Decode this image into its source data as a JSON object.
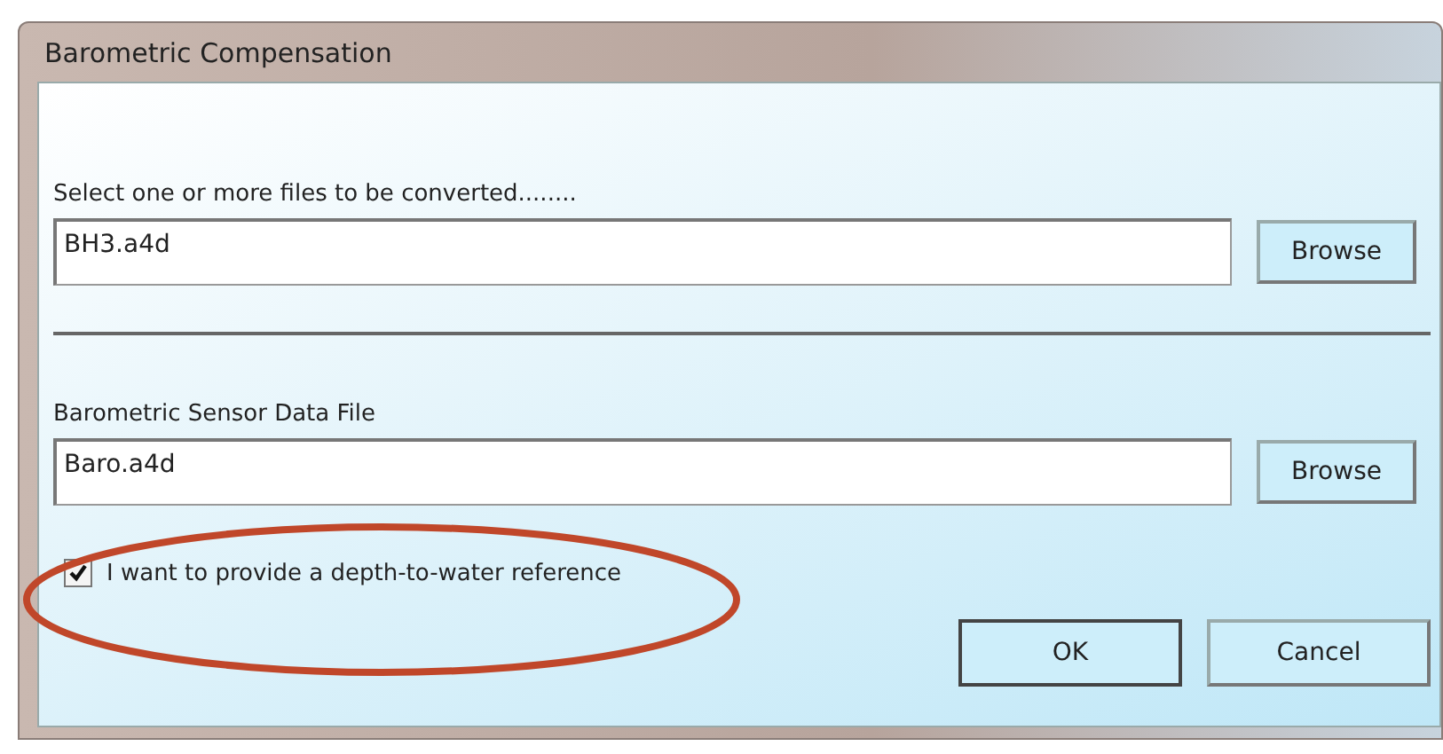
{
  "window": {
    "title": "Barometric Compensation"
  },
  "file_sections": [
    {
      "label": "Select one or more files to be converted........",
      "value": "BH3.a4d",
      "button": "Browse"
    },
    {
      "label": "Barometric Sensor Data File",
      "value": "Baro.a4d",
      "button": "Browse"
    }
  ],
  "checkbox": {
    "label": "I want to provide a depth-to-water reference",
    "checked": true
  },
  "buttons": [
    {
      "label": "OK",
      "default": true
    },
    {
      "label": "Cancel",
      "default": false
    }
  ]
}
